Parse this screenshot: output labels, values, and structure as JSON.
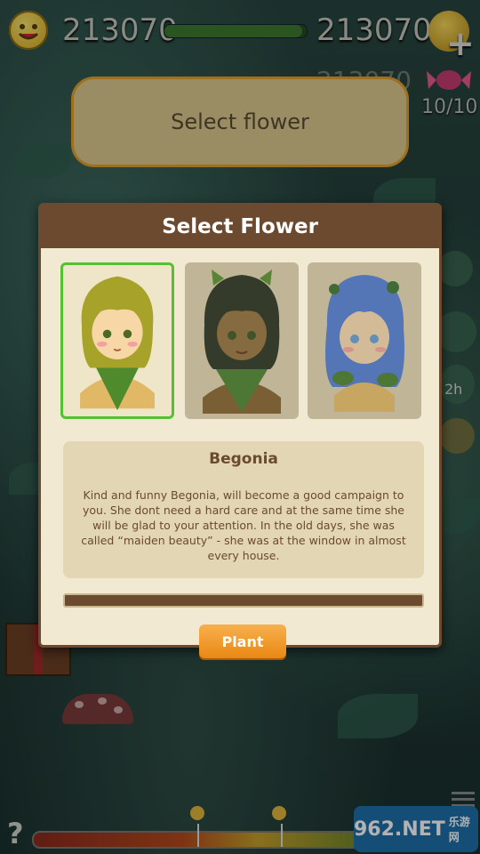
{
  "hud": {
    "left_value": "213070",
    "right_value": "213070",
    "ghost_value": "213070",
    "lives": "10/10",
    "xp_progress_percent": 97
  },
  "banner": {
    "text": "Select flower"
  },
  "side": {
    "timer_label": "2h"
  },
  "dialog": {
    "title": "Select Flower",
    "flowers": [
      {
        "name": "Begonia",
        "selected": true,
        "hair_color": "#a6a22a"
      },
      {
        "name": "dark-haired-flower",
        "selected": false,
        "hair_color": "#1f2a1e"
      },
      {
        "name": "blue-haired-flower",
        "selected": false,
        "hair_color": "#4a78d8"
      }
    ],
    "selected_name": "Begonia",
    "description": "Kind and funny Begonia, will become a good campaign to you. She dont need a hard care and at the same time she  will  be glad to your attention. In the old days, she was called “maiden beauty” - she was at the window in almost every house.",
    "plant_label": "Plant"
  },
  "watermark": {
    "text": "962.NET",
    "sub": "乐游网"
  },
  "colors": {
    "accent_orange": "#e98814",
    "selection_green": "#52c232",
    "panel_brown": "#6b4a2f"
  }
}
